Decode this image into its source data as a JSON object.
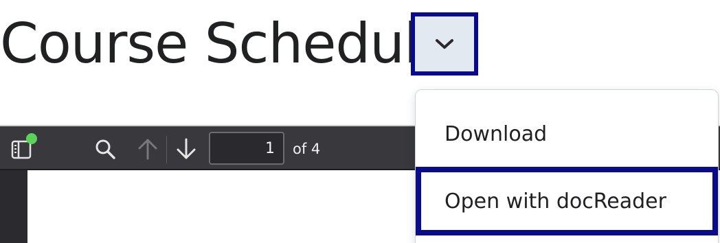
{
  "header": {
    "title": "Course Schedule",
    "menu_toggle_icon": "chevron-down-icon"
  },
  "pdf_toolbar": {
    "sidebar_icon": "sidebar-toggle-icon",
    "search_icon": "search-icon",
    "prev_icon": "arrow-up-icon",
    "next_icon": "arrow-down-icon",
    "page_number": "1",
    "page_count_label": "of 4"
  },
  "dropdown": {
    "items": [
      {
        "label": "Download"
      },
      {
        "label": "Open with docReader"
      }
    ]
  },
  "colors": {
    "focus_outline": "#0a0a8c",
    "toggle_bg": "#e3e9f1",
    "toolbar_bg": "#38383d",
    "notification_dot": "#5bd35b"
  }
}
